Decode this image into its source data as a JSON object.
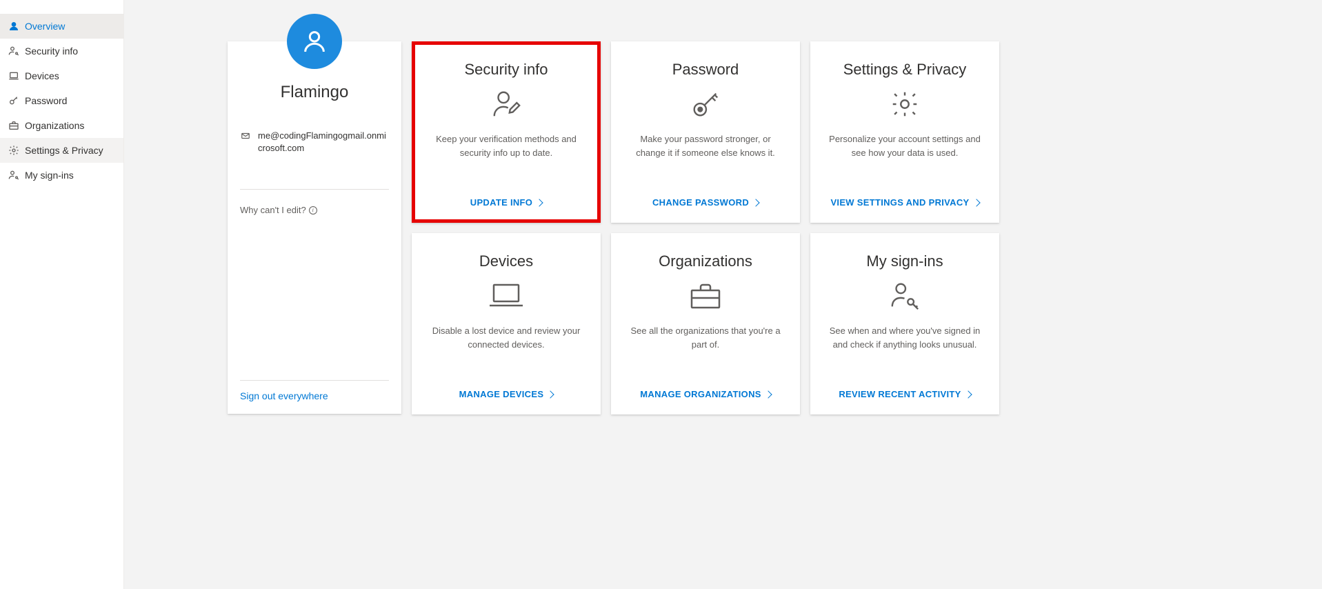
{
  "sidebar": {
    "items": [
      {
        "label": "Overview",
        "icon": "person"
      },
      {
        "label": "Security info",
        "icon": "person-key"
      },
      {
        "label": "Devices",
        "icon": "laptop"
      },
      {
        "label": "Password",
        "icon": "key"
      },
      {
        "label": "Organizations",
        "icon": "briefcase"
      },
      {
        "label": "Settings & Privacy",
        "icon": "gear"
      },
      {
        "label": "My sign-ins",
        "icon": "person-key"
      }
    ]
  },
  "profile": {
    "name": "Flamingo",
    "email": "me@codingFlamingogmail.onmicrosoft.com",
    "why_cant_edit": "Why can't I edit?",
    "signout_text": "Sign out everywhere"
  },
  "tiles": [
    {
      "title": "Security info",
      "desc": "Keep your verification methods and security info up to date.",
      "action": "UPDATE INFO",
      "highlight": true,
      "icon": "person-edit"
    },
    {
      "title": "Password",
      "desc": "Make your password stronger, or change it if someone else knows it.",
      "action": "CHANGE PASSWORD",
      "icon": "key-large"
    },
    {
      "title": "Settings & Privacy",
      "desc": "Personalize your account settings and see how your data is used.",
      "action": "VIEW SETTINGS AND PRIVACY",
      "icon": "gear-large"
    },
    {
      "title": "Devices",
      "desc": "Disable a lost device and review your connected devices.",
      "action": "MANAGE DEVICES",
      "icon": "laptop-large"
    },
    {
      "title": "Organizations",
      "desc": "See all the organizations that you're a part of.",
      "action": "MANAGE ORGANIZATIONS",
      "icon": "briefcase-large"
    },
    {
      "title": "My sign-ins",
      "desc": "See when and where you've signed in and check if anything looks unusual.",
      "action": "REVIEW RECENT ACTIVITY",
      "icon": "person-key-large"
    }
  ]
}
